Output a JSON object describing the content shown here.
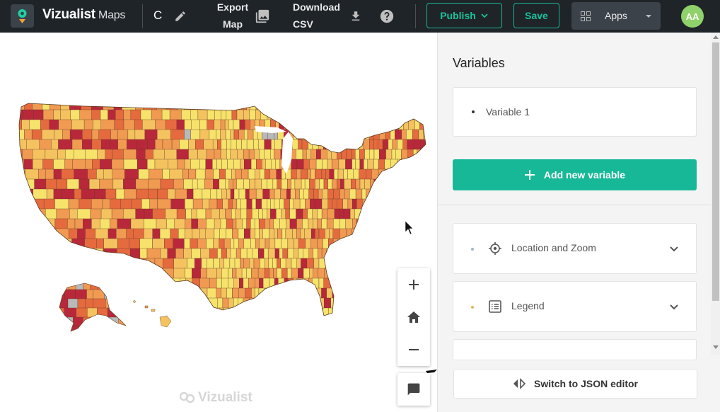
{
  "header": {
    "brand": "Vizualist",
    "brand_sub": "Maps",
    "map_name": "C",
    "export_line1": "Export",
    "export_line2": "Map",
    "download_line1": "Download",
    "download_line2": "CSV",
    "publish_label": "Publish",
    "save_label": "Save",
    "apps_label": "Apps",
    "avatar_initials": "AA"
  },
  "map": {
    "watermark": "Vizualist",
    "legend_palette": [
      "#f7e26b",
      "#f5c260",
      "#f09a52",
      "#e56a3e",
      "#b8283a",
      "#b9b9b9"
    ]
  },
  "panel": {
    "title": "Variables",
    "variables": [
      {
        "label": "Variable 1"
      }
    ],
    "add_variable_label": "Add new variable",
    "sections": [
      {
        "label": "Location and Zoom",
        "dot_color": "#9db7c6"
      },
      {
        "label": "Legend",
        "dot_color": "#e2b560"
      }
    ],
    "json_editor_label": "Switch to JSON editor"
  },
  "colors": {
    "accent": "#17b898",
    "topbar_bg": "#1f2429"
  }
}
